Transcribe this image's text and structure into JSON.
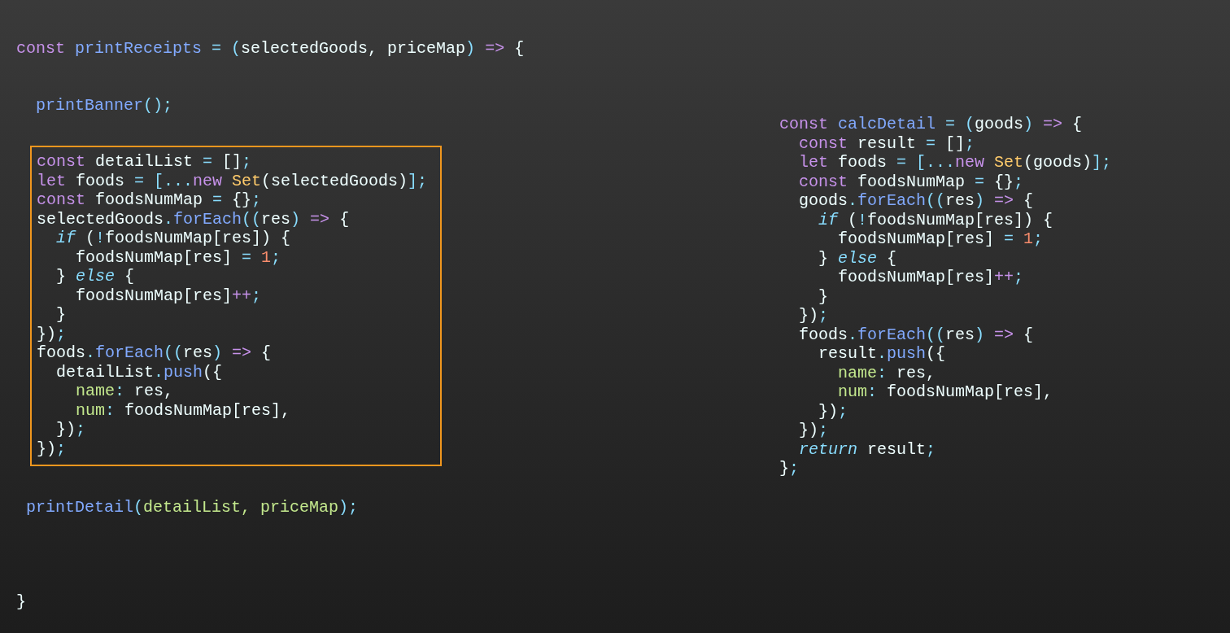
{
  "left_code": [
    {
      "kind": "line",
      "tokens": [
        {
          "kind": "kw",
          "text": "const "
        },
        {
          "kind": "fn",
          "text": "printReceipts"
        },
        {
          "kind": "op",
          "text": " = ("
        },
        {
          "kind": "id",
          "text": "selectedGoods, priceMap"
        },
        {
          "kind": "op",
          "text": ") "
        },
        {
          "kind": "kw",
          "text": "=>"
        },
        {
          "kind": "id",
          "text": " {"
        }
      ]
    },
    {
      "kind": "line",
      "tokens": [
        {
          "kind": "fn",
          "text": "  printBanner"
        },
        {
          "kind": "op",
          "text": "();"
        }
      ]
    },
    {
      "kind": "highlight_box",
      "lines": [
        [
          {
            "kind": "kw",
            "text": "const "
          },
          {
            "kind": "id",
            "text": "detailList "
          },
          {
            "kind": "op",
            "text": "= "
          },
          {
            "kind": "id",
            "text": "[]"
          },
          {
            "kind": "op",
            "text": ";"
          }
        ],
        [
          {
            "kind": "kw",
            "text": "let "
          },
          {
            "kind": "id",
            "text": "foods "
          },
          {
            "kind": "op",
            "text": "= [..."
          },
          {
            "kind": "kw",
            "text": "new "
          },
          {
            "kind": "cls",
            "text": "Set"
          },
          {
            "kind": "id",
            "text": "(selectedGoods)"
          },
          {
            "kind": "op",
            "text": "];"
          }
        ],
        [
          {
            "kind": "kw",
            "text": "const "
          },
          {
            "kind": "id",
            "text": "foodsNumMap "
          },
          {
            "kind": "op",
            "text": "= "
          },
          {
            "kind": "id",
            "text": "{}"
          },
          {
            "kind": "op",
            "text": ";"
          }
        ],
        [
          {
            "kind": "id",
            "text": "selectedGoods"
          },
          {
            "kind": "op",
            "text": "."
          },
          {
            "kind": "fn",
            "text": "forEach"
          },
          {
            "kind": "op",
            "text": "(("
          },
          {
            "kind": "id",
            "text": "res"
          },
          {
            "kind": "op",
            "text": ") "
          },
          {
            "kind": "kw",
            "text": "=>"
          },
          {
            "kind": "id",
            "text": " {"
          }
        ],
        [
          {
            "kind": "ctl",
            "text": "  if"
          },
          {
            "kind": "id",
            "text": " ("
          },
          {
            "kind": "op",
            "text": "!"
          },
          {
            "kind": "id",
            "text": "foodsNumMap[res]) {"
          }
        ],
        [
          {
            "kind": "id",
            "text": "    foodsNumMap[res] "
          },
          {
            "kind": "op",
            "text": "= "
          },
          {
            "kind": "num",
            "text": "1"
          },
          {
            "kind": "op",
            "text": ";"
          }
        ],
        [
          {
            "kind": "id",
            "text": "  } "
          },
          {
            "kind": "ctl",
            "text": "else"
          },
          {
            "kind": "id",
            "text": " {"
          }
        ],
        [
          {
            "kind": "id",
            "text": "    foodsNumMap[res]"
          },
          {
            "kind": "kw",
            "text": "++"
          },
          {
            "kind": "op",
            "text": ";"
          }
        ],
        [
          {
            "kind": "id",
            "text": "  }"
          }
        ],
        [
          {
            "kind": "id",
            "text": "})"
          },
          {
            "kind": "op",
            "text": ";"
          }
        ],
        [
          {
            "kind": "id",
            "text": "foods"
          },
          {
            "kind": "op",
            "text": "."
          },
          {
            "kind": "fn",
            "text": "forEach"
          },
          {
            "kind": "op",
            "text": "(("
          },
          {
            "kind": "id",
            "text": "res"
          },
          {
            "kind": "op",
            "text": ") "
          },
          {
            "kind": "kw",
            "text": "=>"
          },
          {
            "kind": "id",
            "text": " {"
          }
        ],
        [
          {
            "kind": "id",
            "text": "  detailList"
          },
          {
            "kind": "op",
            "text": "."
          },
          {
            "kind": "fn",
            "text": "push"
          },
          {
            "kind": "id",
            "text": "({"
          }
        ],
        [
          {
            "kind": "key",
            "text": "    name"
          },
          {
            "kind": "op",
            "text": ": "
          },
          {
            "kind": "id",
            "text": "res,"
          }
        ],
        [
          {
            "kind": "key",
            "text": "    num"
          },
          {
            "kind": "op",
            "text": ": "
          },
          {
            "kind": "id",
            "text": "foodsNumMap[res],"
          }
        ],
        [
          {
            "kind": "id",
            "text": "  })"
          },
          {
            "kind": "op",
            "text": ";"
          }
        ],
        [
          {
            "kind": "id",
            "text": "})"
          },
          {
            "kind": "op",
            "text": ";"
          }
        ]
      ]
    },
    {
      "kind": "line",
      "tokens": [
        {
          "kind": "fn",
          "text": " printDetail"
        },
        {
          "kind": "op",
          "text": "("
        },
        {
          "kind": "arg",
          "text": "detailList, priceMap"
        },
        {
          "kind": "op",
          "text": ");"
        }
      ]
    },
    {
      "kind": "line",
      "tokens": [
        {
          "kind": "id",
          "text": "}"
        }
      ]
    }
  ],
  "right_code": [
    [
      {
        "kind": "kw",
        "text": "const "
      },
      {
        "kind": "fn",
        "text": "calcDetail"
      },
      {
        "kind": "op",
        "text": " = ("
      },
      {
        "kind": "id",
        "text": "goods"
      },
      {
        "kind": "op",
        "text": ") "
      },
      {
        "kind": "kw",
        "text": "=>"
      },
      {
        "kind": "id",
        "text": " {"
      }
    ],
    [
      {
        "kind": "kw",
        "text": "  const "
      },
      {
        "kind": "id",
        "text": "result "
      },
      {
        "kind": "op",
        "text": "= "
      },
      {
        "kind": "id",
        "text": "[]"
      },
      {
        "kind": "op",
        "text": ";"
      }
    ],
    [
      {
        "kind": "kw",
        "text": "  let "
      },
      {
        "kind": "id",
        "text": "foods "
      },
      {
        "kind": "op",
        "text": "= [..."
      },
      {
        "kind": "kw",
        "text": "new "
      },
      {
        "kind": "cls",
        "text": "Set"
      },
      {
        "kind": "id",
        "text": "(goods)"
      },
      {
        "kind": "op",
        "text": "];"
      }
    ],
    [
      {
        "kind": "kw",
        "text": "  const "
      },
      {
        "kind": "id",
        "text": "foodsNumMap "
      },
      {
        "kind": "op",
        "text": "= "
      },
      {
        "kind": "id",
        "text": "{}"
      },
      {
        "kind": "op",
        "text": ";"
      }
    ],
    [
      {
        "kind": "id",
        "text": "  goods"
      },
      {
        "kind": "op",
        "text": "."
      },
      {
        "kind": "fn",
        "text": "forEach"
      },
      {
        "kind": "op",
        "text": "(("
      },
      {
        "kind": "id",
        "text": "res"
      },
      {
        "kind": "op",
        "text": ") "
      },
      {
        "kind": "kw",
        "text": "=>"
      },
      {
        "kind": "id",
        "text": " {"
      }
    ],
    [
      {
        "kind": "ctl",
        "text": "    if"
      },
      {
        "kind": "id",
        "text": " ("
      },
      {
        "kind": "op",
        "text": "!"
      },
      {
        "kind": "id",
        "text": "foodsNumMap[res]) {"
      }
    ],
    [
      {
        "kind": "id",
        "text": "      foodsNumMap[res] "
      },
      {
        "kind": "op",
        "text": "= "
      },
      {
        "kind": "num",
        "text": "1"
      },
      {
        "kind": "op",
        "text": ";"
      }
    ],
    [
      {
        "kind": "id",
        "text": "    } "
      },
      {
        "kind": "ctl",
        "text": "else"
      },
      {
        "kind": "id",
        "text": " {"
      }
    ],
    [
      {
        "kind": "id",
        "text": "      foodsNumMap[res]"
      },
      {
        "kind": "kw",
        "text": "++"
      },
      {
        "kind": "op",
        "text": ";"
      }
    ],
    [
      {
        "kind": "id",
        "text": "    }"
      }
    ],
    [
      {
        "kind": "id",
        "text": "  })"
      },
      {
        "kind": "op",
        "text": ";"
      }
    ],
    [
      {
        "kind": "id",
        "text": "  foods"
      },
      {
        "kind": "op",
        "text": "."
      },
      {
        "kind": "fn",
        "text": "forEach"
      },
      {
        "kind": "op",
        "text": "(("
      },
      {
        "kind": "id",
        "text": "res"
      },
      {
        "kind": "op",
        "text": ") "
      },
      {
        "kind": "kw",
        "text": "=>"
      },
      {
        "kind": "id",
        "text": " {"
      }
    ],
    [
      {
        "kind": "id",
        "text": "    result"
      },
      {
        "kind": "op",
        "text": "."
      },
      {
        "kind": "fn",
        "text": "push"
      },
      {
        "kind": "id",
        "text": "({"
      }
    ],
    [
      {
        "kind": "key",
        "text": "      name"
      },
      {
        "kind": "op",
        "text": ": "
      },
      {
        "kind": "id",
        "text": "res,"
      }
    ],
    [
      {
        "kind": "key",
        "text": "      num"
      },
      {
        "kind": "op",
        "text": ": "
      },
      {
        "kind": "id",
        "text": "foodsNumMap[res],"
      }
    ],
    [
      {
        "kind": "id",
        "text": "    })"
      },
      {
        "kind": "op",
        "text": ";"
      }
    ],
    [
      {
        "kind": "id",
        "text": "  })"
      },
      {
        "kind": "op",
        "text": ";"
      }
    ],
    [
      {
        "kind": "ctl",
        "text": "  return"
      },
      {
        "kind": "id",
        "text": " result"
      },
      {
        "kind": "op",
        "text": ";"
      }
    ],
    [
      {
        "kind": "id",
        "text": "}"
      },
      {
        "kind": "op",
        "text": ";"
      }
    ]
  ]
}
